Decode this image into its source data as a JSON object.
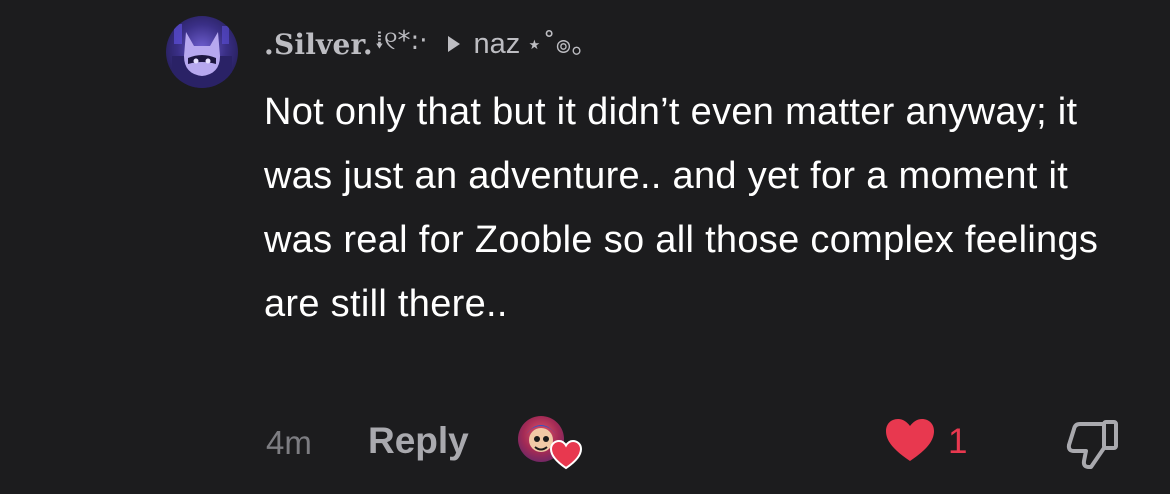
{
  "comment": {
    "author": ".Silver.",
    "author_decoration": "⭭୧*:·",
    "reply_to": "naz",
    "reply_to_decoration": "⋆˚๏。",
    "body": "Not only that but it didn’t even matter anyway; it was just an adventure.. and yet for a moment it was real for Zooble so all those complex feelings are still there..",
    "timestamp": "4m",
    "reply_label": "Reply",
    "like_count": "1"
  },
  "icons": {
    "reply_arrow": "play-arrow-icon",
    "like": "heart-icon",
    "dislike": "thumbs-down-icon",
    "reactor_badge": "heart-icon"
  },
  "colors": {
    "background": "#1c1c1e",
    "text": "#ffffff",
    "muted": "#bdbdc2",
    "timestamp": "#7d7d82",
    "like": "#e8384f"
  }
}
